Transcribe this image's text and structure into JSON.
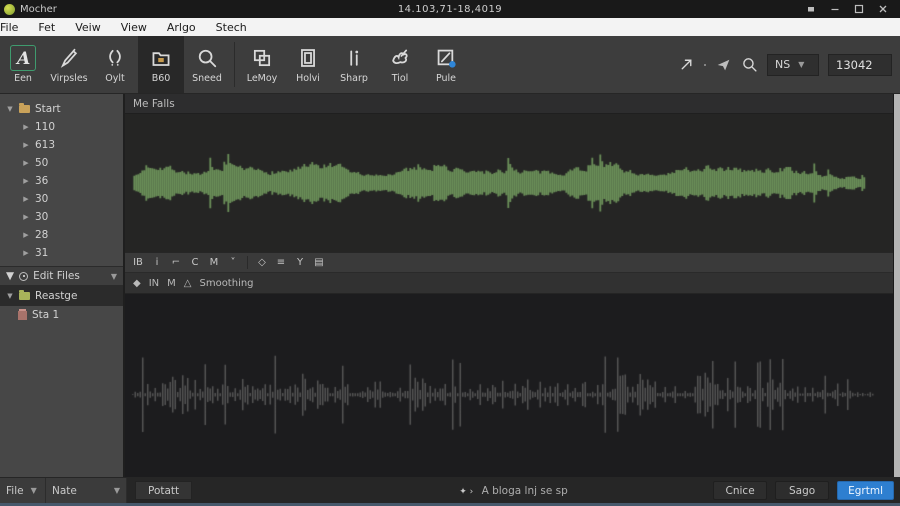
{
  "title_bar": {
    "app_name": "Mocher",
    "document_title": "14.103,71-18,4019"
  },
  "menu_bar": {
    "items": [
      "File",
      "Fet",
      "Veiw",
      "View",
      "Arlgo",
      "Stech"
    ]
  },
  "toolbar": {
    "tools": [
      {
        "label": "Een",
        "icon": "a-tool-icon",
        "outlined": true,
        "darkbg": false,
        "sep_before": false
      },
      {
        "label": "Virpsles",
        "icon": "pen-icon",
        "outlined": false,
        "darkbg": false,
        "sep_before": false
      },
      {
        "label": "Oylt",
        "icon": "curves-icon",
        "outlined": false,
        "darkbg": false,
        "sep_before": false
      },
      {
        "label": "B60",
        "icon": "folder-icon",
        "outlined": false,
        "darkbg": true,
        "sep_before": false
      },
      {
        "label": "Sneed",
        "icon": "magnifier-icon",
        "outlined": false,
        "darkbg": false,
        "sep_before": false
      },
      {
        "label": "LeMoy",
        "icon": "rects-icon",
        "outlined": false,
        "darkbg": false,
        "sep_before": true
      },
      {
        "label": "Holvi",
        "icon": "framed-icon",
        "outlined": false,
        "darkbg": false,
        "sep_before": false
      },
      {
        "label": "Sharp",
        "icon": "bars-icon",
        "outlined": false,
        "darkbg": false,
        "sep_before": false
      },
      {
        "label": "Tiol",
        "icon": "hand-icon",
        "outlined": false,
        "darkbg": false,
        "sep_before": false
      },
      {
        "label": "Pule",
        "icon": "edit-square-icon",
        "outlined": false,
        "darkbg": false,
        "sep_before": false
      }
    ],
    "right": {
      "icons": [
        "arrow-up-right-icon",
        "share-icon",
        "magnifier-icon"
      ],
      "preset_dropdown": {
        "value": "NS"
      },
      "value_field": {
        "value": "13042"
      }
    }
  },
  "sidebar": {
    "tree": {
      "root_label": "Start",
      "items": [
        "110",
        "613",
        "50",
        "36",
        "30",
        "30",
        "28",
        "31"
      ]
    },
    "edit_files_section": {
      "label": "Edit Files"
    },
    "reastge_item": {
      "label": "Reastge",
      "child_label": "Sta 1"
    }
  },
  "top_panel": {
    "header": "Me Falls"
  },
  "lower_panel": {
    "mini_toolbar_groups": [
      [
        "IB",
        "i",
        "⌐",
        "C",
        "M",
        "˅"
      ],
      [
        "◇",
        "≡",
        "Y",
        "▤"
      ]
    ],
    "track_row": {
      "glyphs": [
        "◆",
        "IN",
        "M",
        "△"
      ],
      "label": "Smoothing"
    }
  },
  "bottom_bar": {
    "file_dropdown": "File",
    "rate_dropdown": "Nate",
    "potatt_button": "Potatt",
    "status_text": "A bloga lnj se sp",
    "cancel_button": "Cnice",
    "save_button": "Sago",
    "export_button": "Egrtml"
  },
  "colors": {
    "top_wave": "#6a8f58",
    "top_wave_bg": "#252524",
    "bottom_wave": "#585858",
    "bottom_wave_bg": "#1c1c1e",
    "primary_button": "#2e7fd0",
    "tool_outline": "#3f9b6e"
  },
  "waveforms": {
    "top": {
      "seed": 7,
      "color": "#6a8f58",
      "background": "#252524",
      "start": 0.012,
      "end": 0.955,
      "amp": 26,
      "min_amp": 7,
      "floor": 0.45,
      "shape": 1.2,
      "spike_prob": 0.02,
      "attack": 0.015,
      "release": 0.9,
      "step": 2,
      "smooth": true,
      "center": 0.5,
      "mod1": 41,
      "mod2": 9,
      "line_width": 1.8
    },
    "bottom": {
      "seed": 23,
      "color": "#585858",
      "background": "#1c1c1e",
      "start": 0.01,
      "end": 0.965,
      "amp": 25,
      "min_amp": 1.5,
      "floor": 0.08,
      "shape": 2.1,
      "spike_prob": 0.045,
      "attack": 0.006,
      "release": 0.86,
      "step": 2.5,
      "smooth": false,
      "center": 0.55,
      "mod1": 57,
      "mod2": 13,
      "line_width": 1.4
    }
  }
}
